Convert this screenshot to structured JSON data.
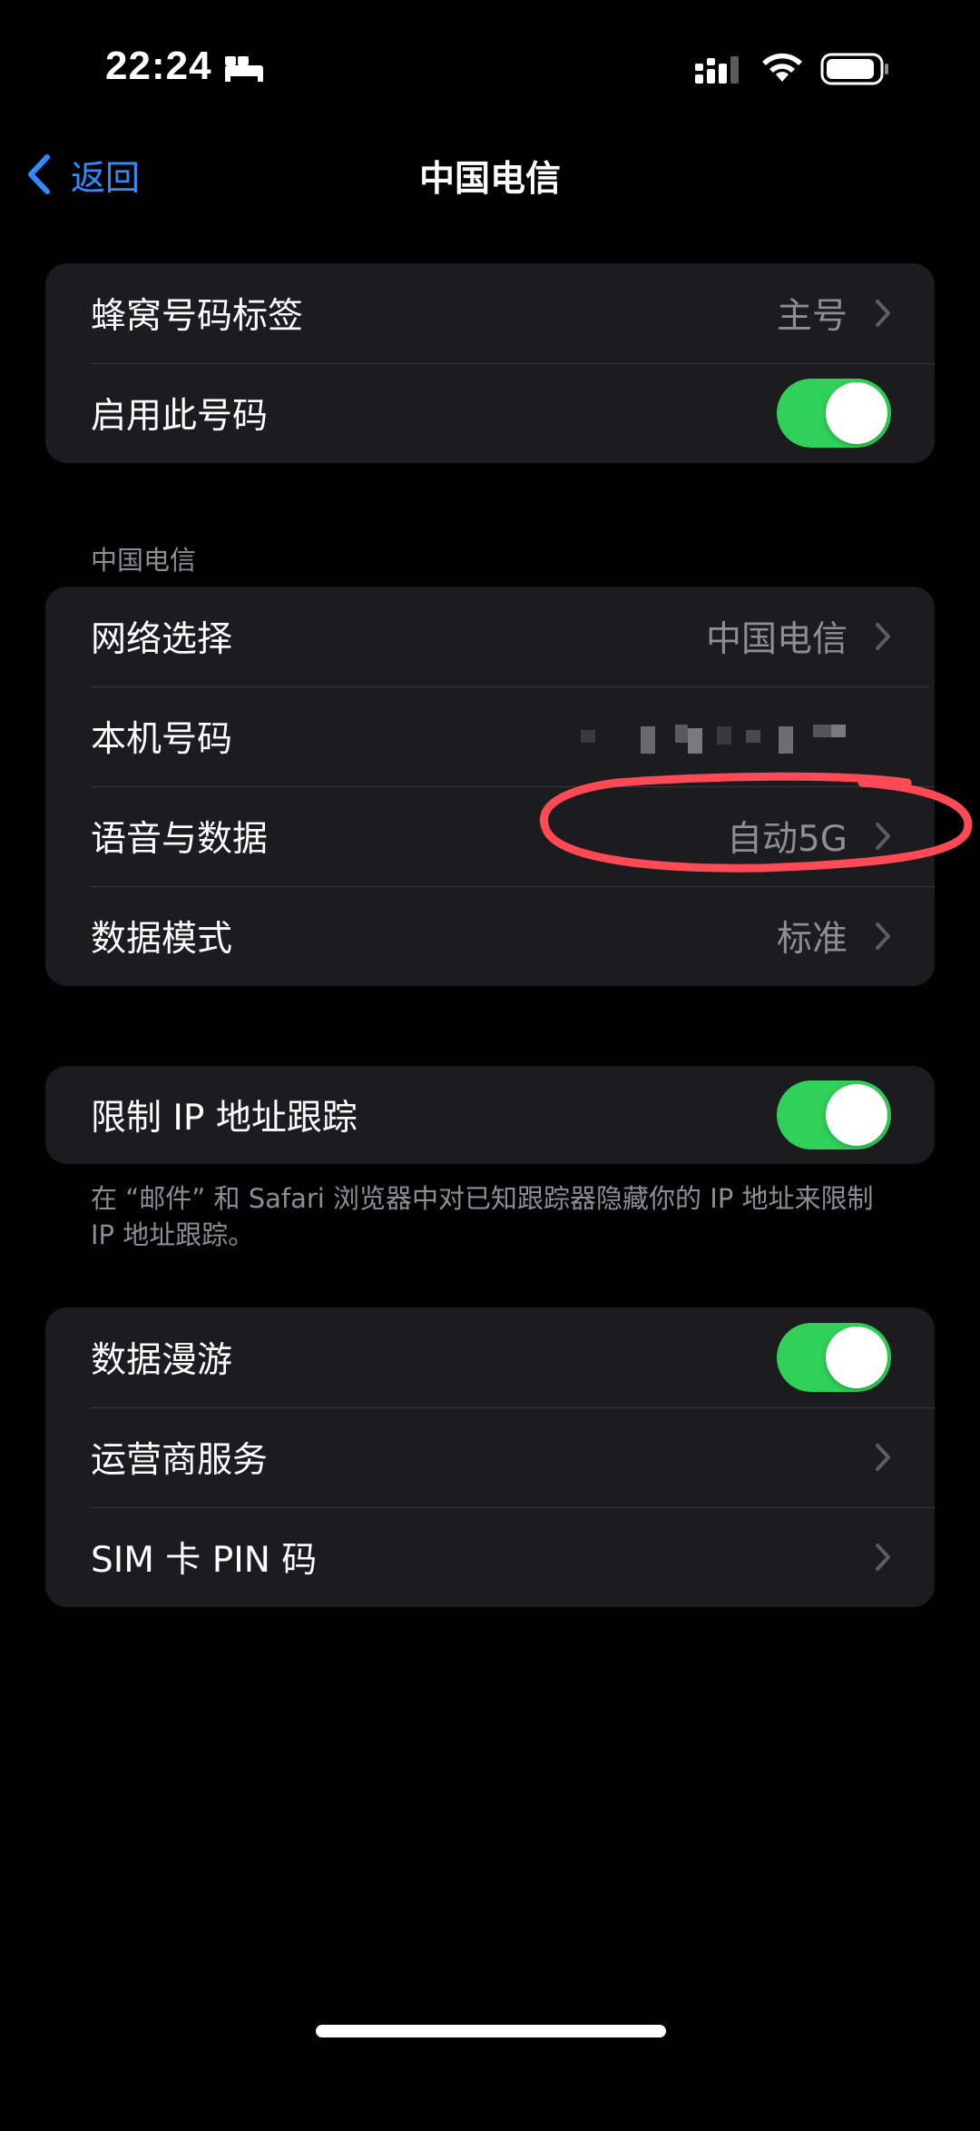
{
  "status_bar": {
    "time": "22:24",
    "icons": [
      "sleep-mode-icon",
      "cellular-signal-icon",
      "wifi-icon",
      "battery-icon"
    ]
  },
  "nav": {
    "back_label": "返回",
    "title": "中国电信"
  },
  "group1": {
    "rows": [
      {
        "label": "蜂窝号码标签",
        "value": "主号",
        "accessory": "chevron"
      },
      {
        "label": "启用此号码",
        "accessory": "toggle",
        "toggle_on": true
      }
    ]
  },
  "group2": {
    "header": "中国电信",
    "rows": [
      {
        "label": "网络选择",
        "value": "中国电信",
        "accessory": "chevron"
      },
      {
        "label": "本机号码",
        "accessory": "pixelated-value"
      },
      {
        "label": "语音与数据",
        "value": "自动5G",
        "accessory": "chevron"
      },
      {
        "label": "数据模式",
        "value": "标准",
        "accessory": "chevron"
      }
    ]
  },
  "group3": {
    "rows": [
      {
        "label": "限制 IP 地址跟踪",
        "accessory": "toggle",
        "toggle_on": true
      }
    ],
    "footer": "在 “邮件” 和 Safari 浏览器中对已知跟踪器隐藏你的 IP 地址来限制 IP 地址跟踪。"
  },
  "group4": {
    "rows": [
      {
        "label": "数据漫游",
        "accessory": "toggle",
        "toggle_on": true
      },
      {
        "label": "运营商服务",
        "accessory": "chevron"
      },
      {
        "label": "SIM 卡 PIN 码",
        "accessory": "chevron"
      }
    ]
  },
  "colors": {
    "background": "#000000",
    "cell": "#1c1c1e",
    "separator": "#38383a",
    "accent_blue": "#2f8cff",
    "toggle_on": "#30d158",
    "secondary_text": "#8d8d93",
    "annotation_red": "#ff4a55"
  }
}
